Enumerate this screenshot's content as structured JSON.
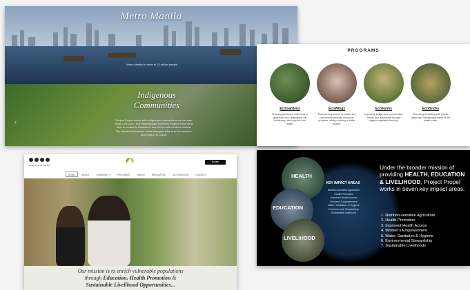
{
  "panel1": {
    "title_city": "Metro Manila",
    "city_text": "Metro Manila is home to 13 million people...",
    "title_indigenous_line1": "Indigenous",
    "title_indigenous_line2": "Communities",
    "indigenous_text": "Project Propel works with indigenous communities on the main island of Luzon. The Pamulaklakin EcoFarm Project of the Aeta tribe is located in Zambales, two hours north of Metro Manila. The Mambulo EcoFarm of the Mangyan tribe is in the southern Bicol region of Luzon.",
    "arrow_left": "‹",
    "arrow_right": "›"
  },
  "programs": {
    "title": "PROGRAMS",
    "items": [
      {
        "label": "EcoGardens",
        "desc": "Teaching families in cities how to grow their own vegetables, eat nutritiously, and improve their health."
      },
      {
        "label": "EcoWings",
        "desc": "Empowering women to create and use environmentally conscious products, while providing a stable income."
      },
      {
        "label": "EcoFarms",
        "desc": "Improving indigenous communities' health and livelihoods through organic vegetable farming."
      },
      {
        "label": "EcoBricks",
        "desc": "Recycling & building with plastic waste and raising awareness of the plastic crisis."
      }
    ]
  },
  "site": {
    "email": "info@projectpropel.org",
    "donate": "Donate",
    "nav": [
      "HOME",
      "ABOUT",
      "COMMUNITY",
      "PROGRAMS",
      "VIDEOS",
      "RESOURCES",
      "GET INVOLVED",
      "CONTACT"
    ],
    "mission_line1": "Our mission is to enrich vulnerable populations",
    "mission_line2_pre": "through ",
    "mission_line2_bold": "Education, Health Promotion",
    "mission_line2_post": " &",
    "mission_line3_bold": "Sustainable Livelihood Opportunities...",
    "slide_arrow_left": "‹",
    "slide_arrow_right": "›"
  },
  "impact": {
    "circle_health": "HEALTH",
    "circle_education": "EDUCATION",
    "circle_livelihood": "LIVELIHOOD",
    "key_title": "KEY IMPACT AREAS",
    "key_list": [
      "Nutrition-sensitive Agriculture",
      "Health Promotion",
      "Improved Health Access",
      "Women's Empowerment",
      "Water, Sanitation, & Hygiene",
      "Environmental Stewardship",
      "Sustainable Livelihood"
    ],
    "intro_pre": "Under the broader mission of providing ",
    "intro_bold": "HEALTH, EDUCATION & LIVELIHOOD",
    "intro_post": ", Project Propel works in seven key impact areas:",
    "areas": [
      "1. Nutrition-sensitive Agriculture",
      "2. Health Promotion",
      "3. Improved Health Access",
      "4. Women's Empowerment",
      "5. Water, Sanitation & Hygiene",
      "6. Environmental Stewardship",
      "7. Sustainable Livelihoods"
    ]
  }
}
